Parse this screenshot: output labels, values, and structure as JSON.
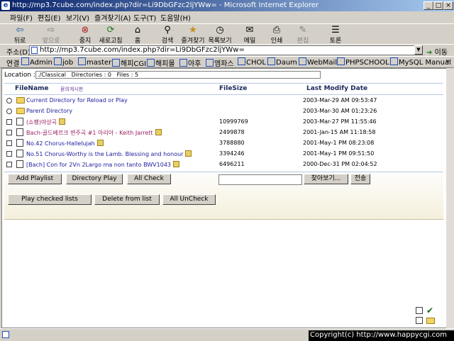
{
  "window": {
    "title": "http://mp3.7cube.com/index.php?dir=Li9DbGFzc2ljYWw= - Microsoft Internet Explorer",
    "minimize": "_",
    "maximize": "□",
    "close": "×"
  },
  "menu": [
    "파일(F)",
    "편집(E)",
    "보기(V)",
    "즐겨찾기(A)",
    "도구(T)",
    "도움말(H)"
  ],
  "toolbar": {
    "back": "뒤로",
    "forward": "앞으로",
    "stop": "중지",
    "refresh": "새로고침",
    "home": "홈",
    "search": "검색",
    "favorites": "즐겨찾기",
    "history": "목록보기",
    "mail": "메일",
    "print": "인쇄",
    "edit": "편집",
    "discuss": "토론"
  },
  "address": {
    "label": "주소(D)",
    "url": "http://mp3.7cube.com/index.php?dir=Li9DbGFzc2ljYWw=",
    "go": "이동"
  },
  "links": {
    "label": "연결",
    "items": [
      "Admin",
      "job",
      "master",
      "해피CGI",
      "해피몰",
      "야후",
      "엠파스",
      "CHOL",
      "Daum",
      "WebMail",
      "PHPSCHOOL",
      "MySQL Manual"
    ]
  },
  "location": {
    "label": "Location :",
    "value": "./Classical   Directories : 0   Files : 5"
  },
  "table": {
    "col_filename": "FileName",
    "col_board": "묻의게시판",
    "col_filesize": "FileSize",
    "col_date": "Last Modify Date",
    "rows": [
      {
        "name": "Current Directory for Reload or Play",
        "size": "",
        "date": "2003-Mar-29 AM 09:53:47"
      },
      {
        "name": "Parent Directory",
        "size": "",
        "date": "2003-Mar-30 AM 01:23:26"
      },
      {
        "name": "(쇼팽)야상곡",
        "size": "10999769",
        "date": "2003-Mar-27 PM 11:55:46"
      },
      {
        "name": "Bach-골드베르크 변주곡 #1 아리아 - Keith Jarrett",
        "size": "2499878",
        "date": "2001-Jan-15 AM 11:18:58"
      },
      {
        "name": "No.42 Chorus-Hallelujah",
        "size": "3788880",
        "date": "2001-May-1 PM 08:23:08"
      },
      {
        "name": "No.51 Chorus-Worthy is the Lamb. Blessing and honour",
        "size": "3394246",
        "date": "2001-May-1 PM 09:51:50"
      },
      {
        "name": "[Bach] Con for 2Vn 2Largo ma non tanto BWV1043",
        "size": "6496211",
        "date": "2000-Dec-31 PM 02:04:52"
      }
    ]
  },
  "actions": {
    "add_playlist": "Add Playlist",
    "directory_play": "Directory Play",
    "all_check": "All Check",
    "browse": "찾아보기...",
    "send": "전송",
    "play_checked": "Play checked lists",
    "delete_list": "Delete from list",
    "all_uncheck": "All UnCheck"
  },
  "status": {
    "copyright": "Copyright(c) http://www.happycgi.com"
  }
}
